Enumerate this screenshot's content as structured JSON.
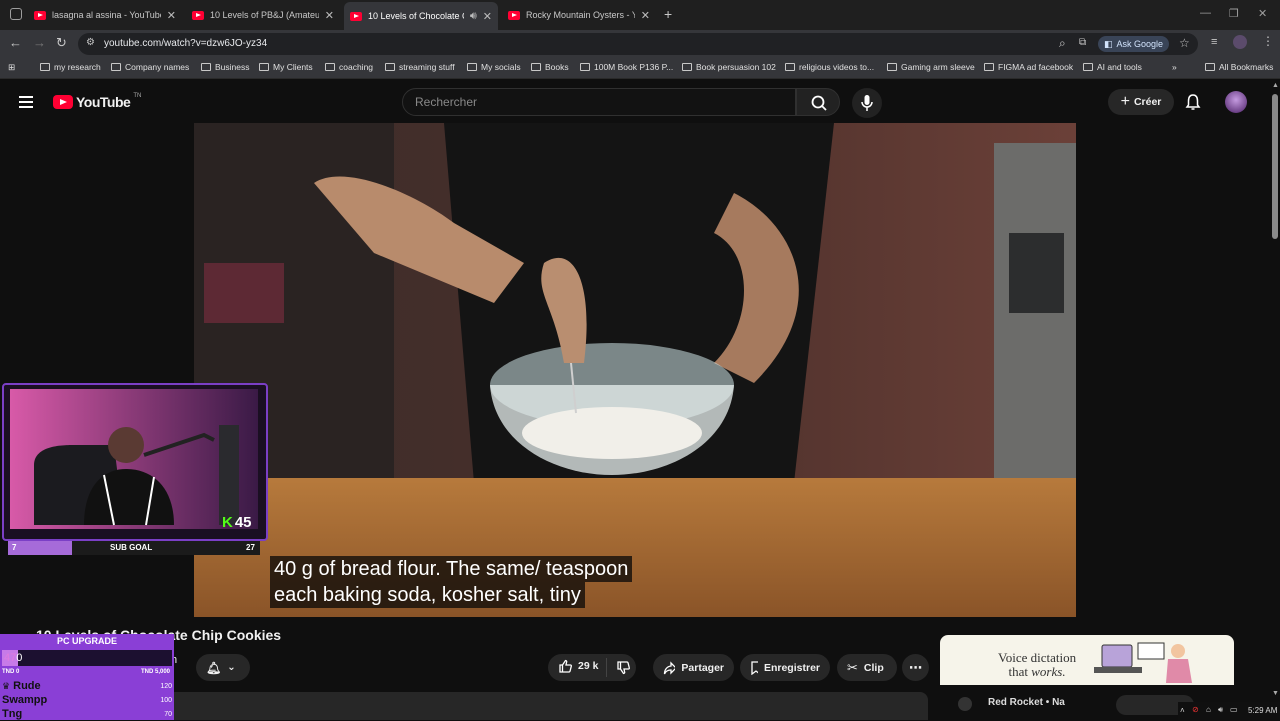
{
  "browser": {
    "tabs": [
      {
        "title": "lasagna al assina - YouTube",
        "active": false
      },
      {
        "title": "10 Levels of PB&J (Amateur to Food Scientist)",
        "active": false
      },
      {
        "title": "10 Levels of Chocolate Chip Cookies",
        "active": true
      },
      {
        "title": "Rocky Mountain Oysters - YouTube",
        "active": false
      }
    ],
    "url": "youtube.com/watch?v=dzw6JO-yz34",
    "ask_google": "Ask Google",
    "bookmarks": [
      "my research",
      "Company names",
      "Business",
      "My Clients",
      "coaching",
      "streaming stuff",
      "My socials",
      "Books",
      "100M Book P136 P...",
      "Book persuasion 102",
      "religious videos to...",
      "Gaming arm sleeve",
      "FIGMA ad facebook",
      "AI and tools"
    ],
    "all_bookmarks": "All Bookmarks"
  },
  "youtube": {
    "logo_text": "YouTube",
    "logo_sup": "TN",
    "search_placeholder": "Rechercher",
    "create_label": "Créer",
    "video_title": "10 Levels of Chocolate Chip Cookies",
    "caption_line1": "40 g of bread flour. The same/ teaspoon",
    "caption_line2": "each baking soda, kosher salt, tiny",
    "likes": "29 k",
    "share_label": "Partager",
    "save_label": "Enregistrer",
    "clip_label": "Clip",
    "channel_partial": "h",
    "ad_text1": "Voice dictation",
    "ad_text2": "that ",
    "ad_text3": "works.",
    "next_partial": "Red Rocket • Na"
  },
  "stream": {
    "kick_count": "45",
    "goal_left": "7",
    "goal_label": "SUB GOAL",
    "goal_right": "27",
    "pc_title": "PC UPGRADE",
    "pc_amount_a": "47",
    "pc_amount_b": "0",
    "pc_min": "TND 0",
    "pc_max": "TND 5,000",
    "leaderboard": [
      {
        "name": "Rude",
        "score": "120"
      },
      {
        "name": "Swampp",
        "score": "100"
      },
      {
        "name": "Tng",
        "score": "70"
      }
    ],
    "pc_progress": 0.094
  },
  "system": {
    "clock": "5:29 AM"
  }
}
